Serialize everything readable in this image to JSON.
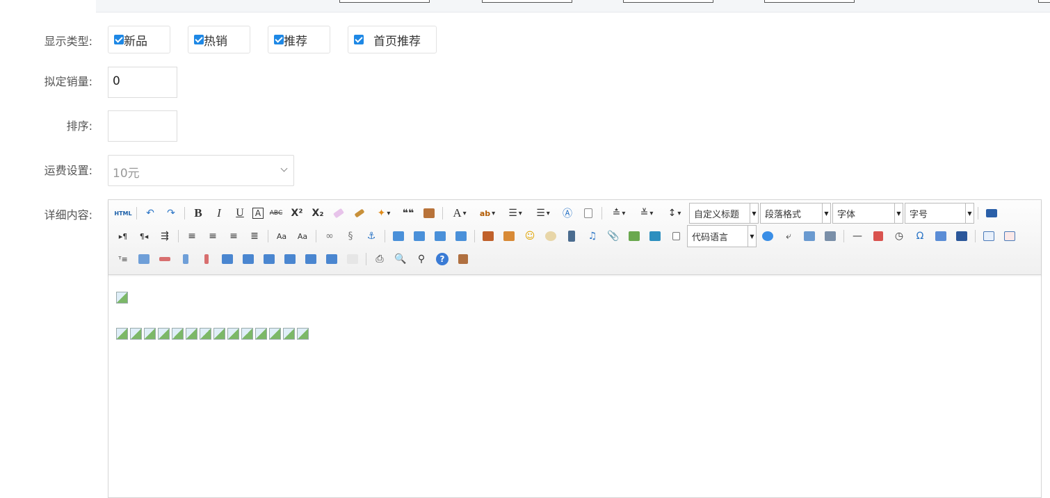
{
  "form": {
    "display_type_label": "显示类型:",
    "display_type_options": [
      "新品",
      "热销",
      "推荐",
      "首页推荐"
    ],
    "sales_label": "拟定销量:",
    "sales_value": "0",
    "sort_label": "排序:",
    "sort_value": "",
    "shipping_label": "运费设置:",
    "shipping_value": "10元",
    "detail_label": "详细内容:"
  },
  "editor": {
    "combos": {
      "custom_heading": "自定义标题",
      "paragraph": "段落格式",
      "font_family": "字体",
      "font_size": "字号",
      "code_language": "代码语言"
    },
    "html_button": "HTML",
    "icons": {
      "bold": "B",
      "italic": "I",
      "underline": "U",
      "border": "A",
      "strike": "ABC",
      "superscript": "X²",
      "subscript": "X₂",
      "quote": "❝❝",
      "font_color": "A",
      "highlight": "ab",
      "letter_case": "Aa",
      "anchor": "⚓",
      "omega": "Ω",
      "help": "?",
      "hr": "—"
    }
  },
  "colors": {
    "accent": "#1e88e5"
  }
}
